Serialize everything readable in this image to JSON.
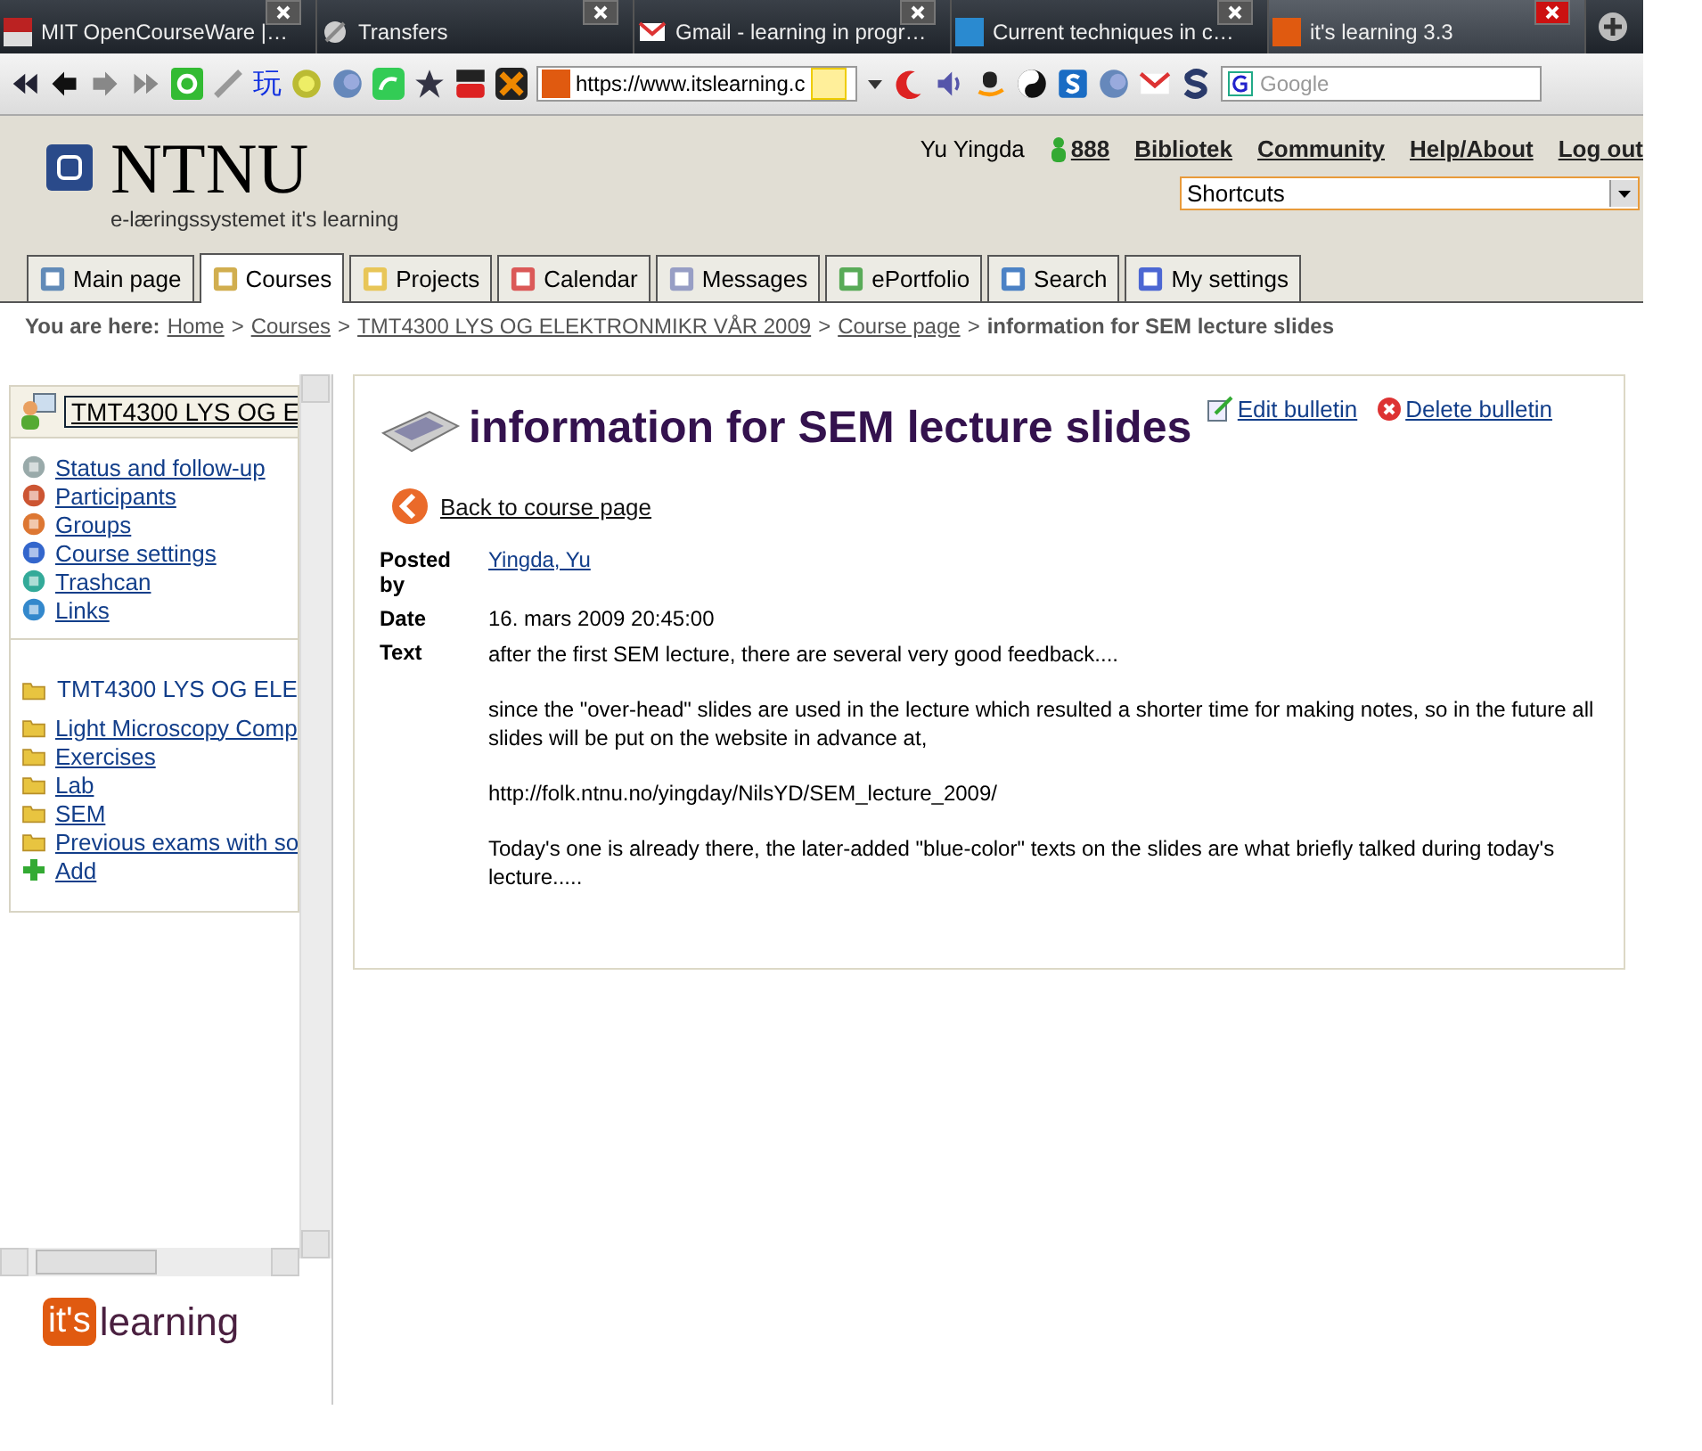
{
  "browser_tabs": [
    {
      "title": "MIT OpenCourseWare |…",
      "selected": false
    },
    {
      "title": "Transfers",
      "selected": false
    },
    {
      "title": "Gmail - learning in progr…",
      "selected": false
    },
    {
      "title": "Current techniques in c…",
      "selected": false
    },
    {
      "title": "it's learning 3.3",
      "selected": true
    }
  ],
  "toolbar": {
    "glyph": "玩",
    "url": "https://www.itslearning.c",
    "search_placeholder": "Google"
  },
  "header": {
    "logo": "NTNU",
    "subtitle": "e-læringssystemet it's learning",
    "user": "Yu Yingda",
    "online_count": "888",
    "links": [
      "Bibliotek",
      "Community",
      "Help/About",
      "Log out"
    ],
    "shortcuts": "Shortcuts"
  },
  "nav_tabs": [
    {
      "label": "Main page",
      "selected": false
    },
    {
      "label": "Courses",
      "selected": true
    },
    {
      "label": "Projects",
      "selected": false
    },
    {
      "label": "Calendar",
      "selected": false
    },
    {
      "label": "Messages",
      "selected": false
    },
    {
      "label": "ePortfolio",
      "selected": false
    },
    {
      "label": "Search",
      "selected": false
    },
    {
      "label": "My settings",
      "selected": false
    }
  ],
  "breadcrumb": {
    "prefix": "You are here:",
    "separator": ">",
    "links": [
      "Home",
      "Courses",
      "TMT4300 LYS OG ELEKTRONMIKR VÅR 2009",
      "Course page"
    ],
    "current": "information for SEM lecture slides"
  },
  "sidebar": {
    "course_title": "TMT4300 LYS OG E",
    "tools": [
      "Status and follow-up",
      "Participants",
      "Groups",
      "Course settings",
      "Trashcan",
      "Links"
    ],
    "folder_title": "TMT4300 LYS OG ELE",
    "folders": [
      "Light Microscopy Comp",
      "Exercises",
      "Lab",
      "SEM",
      "Previous exams with so"
    ],
    "add": "Add"
  },
  "footer_logo": {
    "badge": "it's",
    "word": "learning"
  },
  "bulletin": {
    "title": "information for SEM lecture slides",
    "actions": [
      "Edit bulletin",
      "Delete bulletin"
    ],
    "back": "Back to course page",
    "fields": [
      {
        "label": "Posted by",
        "kind": "link",
        "value": "Yingda, Yu"
      },
      {
        "label": "Date",
        "kind": "text",
        "value": "16. mars 2009 20:45:00"
      }
    ],
    "text_label": "Text",
    "paragraphs": [
      "after the first SEM lecture, there are several very good feedback....",
      "since the \"over-head\" slides are used in the lecture which resulted a shorter time for making notes, so in the future all slides will be put on the website in advance at,",
      "http://folk.ntnu.no/yingday/NilsYD/SEM_lecture_2009/",
      "Today's one is already there, the later-added \"blue-color\" texts on the slides are what briefly talked during today's lecture....."
    ]
  }
}
